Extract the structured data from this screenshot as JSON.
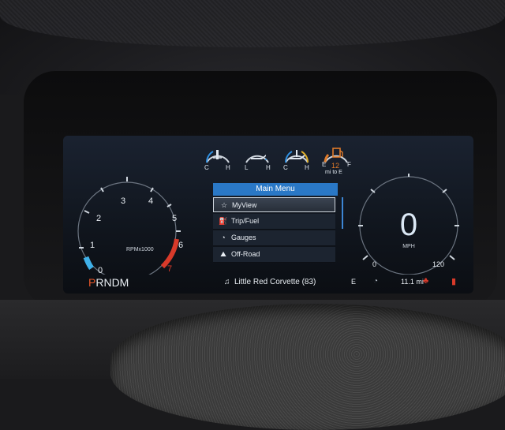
{
  "top_gauges": [
    {
      "name": "coolant-temp-gauge",
      "icon": "coolant-temp-icon",
      "left": "C",
      "right": "H",
      "color": "#2f8fe0"
    },
    {
      "name": "oil-pressure-gauge",
      "icon": "oil-can-icon",
      "left": "L",
      "right": "H",
      "color": "#2f8fe0"
    },
    {
      "name": "oil-temp-gauge",
      "icon": "oil-temp-icon",
      "left": "C",
      "right": "H",
      "color": "#2f8fe0"
    },
    {
      "name": "fuel-gauge",
      "icon": "fuel-pump-icon",
      "left": "E",
      "right": "F",
      "color": "#e07b2a",
      "value": "12",
      "unit": "mi to E"
    }
  ],
  "tach": {
    "ticks": [
      "0",
      "1",
      "2",
      "3",
      "4",
      "5",
      "6",
      "7"
    ],
    "label": "RPMx1000"
  },
  "menu": {
    "title": "Main Menu",
    "items": [
      {
        "icon": "star-icon",
        "glyph": "☆",
        "label": "MyView",
        "selected": true
      },
      {
        "icon": "fuel-pump-icon",
        "glyph": "⛽",
        "label": "Trip/Fuel",
        "selected": false
      },
      {
        "icon": "gauge-icon",
        "glyph": "◔",
        "label": "Gauges",
        "selected": false
      },
      {
        "icon": "off-road-icon",
        "glyph": "⛰",
        "label": "Off-Road",
        "selected": false
      }
    ]
  },
  "speedometer": {
    "value": "0",
    "unit": "MPH",
    "min": "0",
    "max": "120"
  },
  "status": {
    "gear": "PRNDM",
    "gear_active": "P",
    "media": "Little Red Corvette (83)",
    "compass": "E",
    "range": "11.1 mi"
  },
  "colors": {
    "accent": "#2a78c6",
    "warning": "#d83a2a",
    "fuel": "#e07b2a"
  }
}
